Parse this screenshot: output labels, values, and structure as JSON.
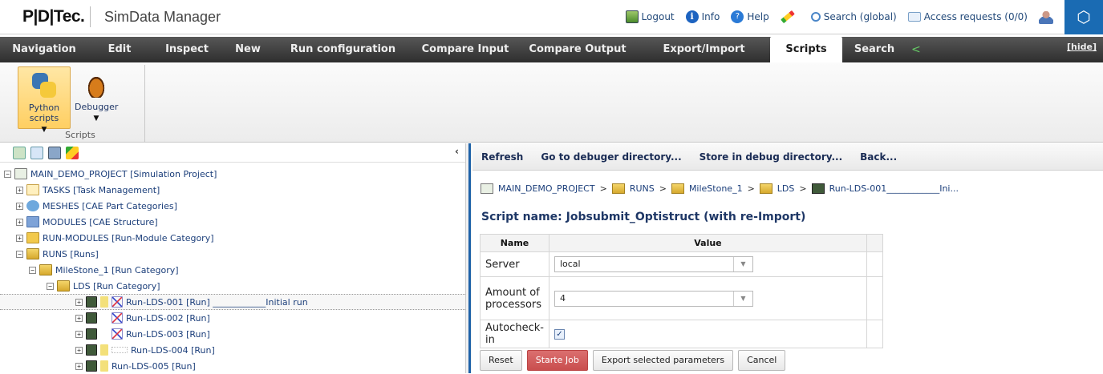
{
  "header": {
    "logo_text": "P|D|Tec.",
    "app_title": "SimData Manager",
    "links": {
      "logout": "Logout",
      "info": "Info",
      "help": "Help",
      "search": "Search (global)",
      "access": "Access requests (0/0)"
    },
    "icons": [
      "logout-icon",
      "info-icon",
      "help-icon",
      "pencil-icon",
      "search-icon",
      "mail-icon",
      "user-icon",
      "cube-icon"
    ]
  },
  "menu": {
    "items": [
      {
        "label": "Navigation",
        "active": false
      },
      {
        "label": "Edit",
        "active": false
      },
      {
        "label": "Inspect",
        "active": false
      },
      {
        "label": "New",
        "active": false
      },
      {
        "label": "Run configuration",
        "active": false
      },
      {
        "label": "Compare Input",
        "active": false
      },
      {
        "label": "Compare Output",
        "active": false
      },
      {
        "label": "Export/Import",
        "active": false
      },
      {
        "label": "Scripts",
        "active": true
      },
      {
        "label": "Search",
        "active": false
      }
    ],
    "hide_label": "[hide]"
  },
  "ribbon": {
    "buttons": {
      "python": "Python scripts",
      "debugger": "Debugger"
    },
    "group_label": "Scripts"
  },
  "tree": {
    "nodes": [
      {
        "label": "MAIN_DEMO_PROJECT [Simulation Project]",
        "expander": "−"
      },
      {
        "label": "TASKS [Task Management]",
        "expander": "+"
      },
      {
        "label": "MESHES [CAE Part Categories]",
        "expander": "+"
      },
      {
        "label": "MODULES [CAE Structure]",
        "expander": "+"
      },
      {
        "label": "RUN-MODULES [Run-Module Category]",
        "expander": "+"
      },
      {
        "label": "RUNS [Runs]",
        "expander": "−"
      },
      {
        "label": "MileStone_1 [Run Category]",
        "expander": "−"
      },
      {
        "label": "LDS [Run Category]",
        "expander": "−"
      },
      {
        "label": "Run-LDS-001 [Run] ____________Initial run",
        "expander": "+"
      },
      {
        "label": "Run-LDS-002 [Run]",
        "expander": "+"
      },
      {
        "label": "Run-LDS-003 [Run]",
        "expander": "+"
      },
      {
        "label": "Run-LDS-004 [Run]",
        "expander": "+"
      },
      {
        "label": "Run-LDS-005 [Run]",
        "expander": "+"
      }
    ]
  },
  "right": {
    "toolbar": {
      "refresh": "Refresh",
      "goto": "Go to debuger directory...",
      "store": "Store in debug directory...",
      "back": "Back..."
    },
    "breadcrumb": [
      "MAIN_DEMO_PROJECT",
      "RUNS",
      "MileStone_1",
      "LDS",
      "Run-LDS-001____________Ini..."
    ],
    "breadcrumb_sep": ">",
    "script_title": "Script name: Jobsubmit_Optistruct (with re-Import)",
    "table": {
      "headers": {
        "name": "Name",
        "value": "Value"
      },
      "rows": {
        "server_label": "Server",
        "server_value": "local",
        "proc_label": "Amount of processors",
        "proc_value": "4",
        "autocheck_label": "Autocheck-in",
        "autocheck_checked": "✓"
      }
    },
    "buttons": {
      "reset": "Reset",
      "start": "Starte Job",
      "export": "Export selected parameters",
      "cancel": "Cancel"
    }
  },
  "colors": {
    "menu_bg": "#3f3f3f",
    "accent_blue": "#1a6bb3",
    "primary_button": "#cf5656"
  }
}
